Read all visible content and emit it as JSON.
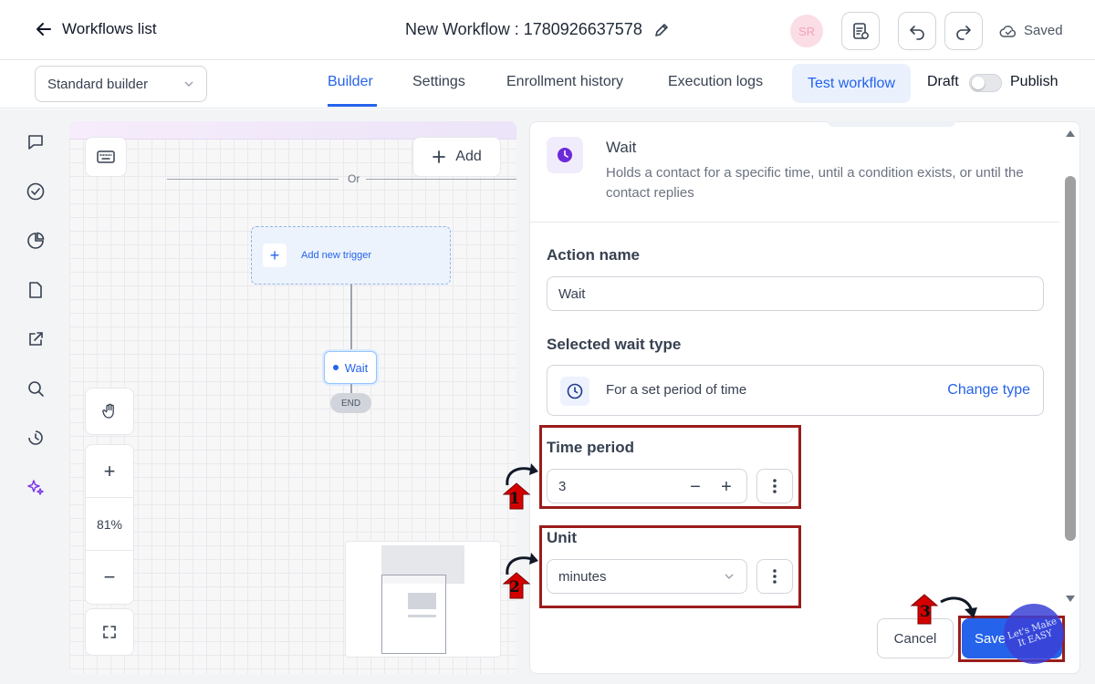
{
  "header": {
    "back_label": "Workflows list",
    "workflow_title": "New Workflow : 1780926637578",
    "avatar_initials": "SR",
    "saved_label": "Saved"
  },
  "subbar": {
    "builder_select": "Standard builder",
    "tabs": [
      {
        "label": "Builder",
        "active": true
      },
      {
        "label": "Settings",
        "active": false
      },
      {
        "label": "Enrollment history",
        "active": false
      },
      {
        "label": "Execution logs",
        "active": false
      }
    ],
    "test_button": "Test workflow",
    "draft_label": "Draft",
    "publish_toggle_on": false,
    "publish_label": "Publish"
  },
  "sidebar": {
    "icons": [
      "chat-icon",
      "check-circle-icon",
      "pie-chart-icon",
      "document-icon",
      "external-link-icon",
      "search-icon",
      "history-icon",
      "sparkles-icon"
    ]
  },
  "canvas": {
    "add_button": "Add",
    "or_label": "Or",
    "add_trigger_label": "Add new trigger",
    "wait_node_label": "Wait",
    "end_label": "END",
    "zoom_level": "81%"
  },
  "panel": {
    "title": "Wait",
    "description": "Holds a contact for a specific time, until a condition exists, or until the contact replies",
    "action_name_label": "Action name",
    "action_name_value": "Wait",
    "wait_type_label": "Selected wait type",
    "wait_type_value": "For a set period of time",
    "change_type_link": "Change type",
    "time_period_label": "Time period",
    "time_period_value": "3",
    "unit_label": "Unit",
    "unit_value": "minutes",
    "cancel_button": "Cancel",
    "save_button": "Save"
  },
  "annotations": {
    "step1": "1",
    "step2": "2",
    "step3": "3",
    "watermark": "Let's Make It EASY"
  },
  "colors": {
    "accent": "#2563eb",
    "annotation_red": "#9b1c1c",
    "wait_icon": "#6d28d9"
  }
}
